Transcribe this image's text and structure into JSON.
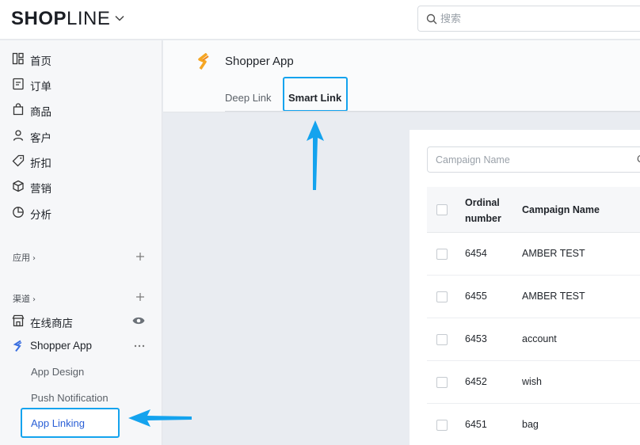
{
  "header": {
    "logo_text_bold": "SHOP",
    "logo_text_light": "LINE",
    "search_placeholder": "搜索"
  },
  "sidebar": {
    "nav": [
      {
        "label": "首页",
        "icon": "dashboard-icon"
      },
      {
        "label": "订单",
        "icon": "order-icon"
      },
      {
        "label": "商品",
        "icon": "bag-icon"
      },
      {
        "label": "客户",
        "icon": "user-icon"
      },
      {
        "label": "折扣",
        "icon": "tag-icon"
      },
      {
        "label": "营销",
        "icon": "cube-icon"
      },
      {
        "label": "分析",
        "icon": "pie-icon"
      }
    ],
    "apps_section": "应用",
    "channels_section": "渠道",
    "online_store": "在线商店",
    "shopper_app": "Shopper App",
    "sub_items": {
      "app_design": "App Design",
      "push_notification": "Push Notification",
      "app_linking": "App Linking"
    }
  },
  "main": {
    "app_title": "Shopper App",
    "tabs": [
      {
        "label": "Deep Link"
      },
      {
        "label": "Smart Link"
      }
    ],
    "campaign_placeholder": "Campaign Name",
    "campaign_trailing": "C",
    "table": {
      "headers": {
        "ordinal": "Ordinal number",
        "name": "Campaign Name"
      },
      "rows": [
        {
          "ordinal": "6454",
          "name": "AMBER TEST"
        },
        {
          "ordinal": "6455",
          "name": "AMBER TEST"
        },
        {
          "ordinal": "6453",
          "name": "account"
        },
        {
          "ordinal": "6452",
          "name": "wish"
        },
        {
          "ordinal": "6451",
          "name": "bag"
        }
      ]
    }
  },
  "colors": {
    "highlight": "#14a3ee",
    "active_text": "#2a5fd6",
    "brand_orange": "#f5a623"
  }
}
